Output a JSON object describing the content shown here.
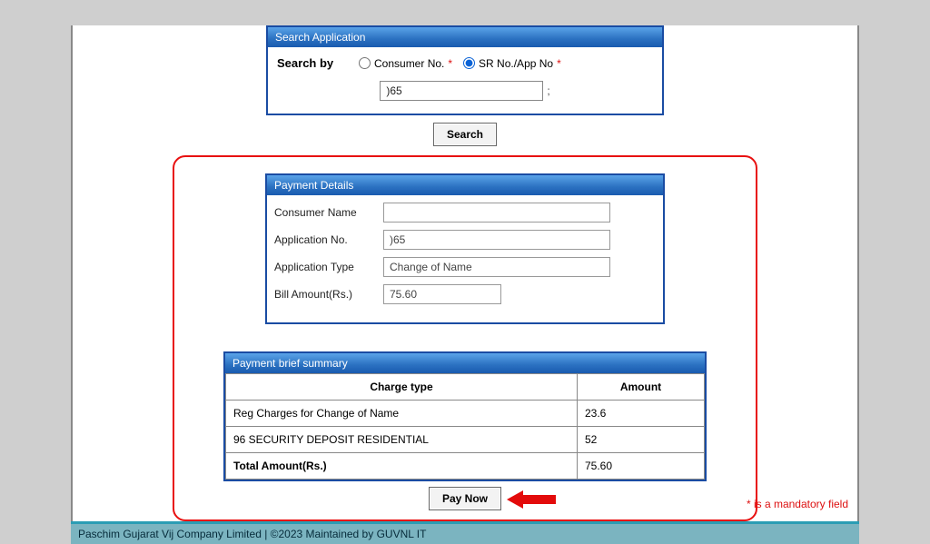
{
  "searchPanel": {
    "title": "Search Application",
    "searchByLabel": "Search by",
    "option1": "Consumer No.",
    "option2": "SR No./App No",
    "requiredMark": "*",
    "inputValue": ")65",
    "trailingChar": ";",
    "searchBtn": "Search"
  },
  "detailsPanel": {
    "title": "Payment Details",
    "fields": [
      {
        "label": "Consumer Name",
        "value": "",
        "short": false
      },
      {
        "label": "Application No.",
        "value": ")65",
        "short": false
      },
      {
        "label": "Application Type",
        "value": "Change of Name",
        "short": false
      },
      {
        "label": "Bill Amount(Rs.)",
        "value": "75.60",
        "short": true
      }
    ]
  },
  "summaryPanel": {
    "title": "Payment brief summary",
    "col1": "Charge type",
    "col2": "Amount",
    "rows": [
      {
        "charge": "Reg Charges for Change of Name",
        "amount": "23.6"
      },
      {
        "charge": "96 SECURITY DEPOSIT RESIDENTIAL",
        "amount": "52"
      }
    ],
    "totalLabel": "Total Amount(Rs.)",
    "totalAmount": "75.60"
  },
  "payNowBtn": "Pay Now",
  "mandatoryNote": "* is a mandatory field",
  "footer": "Paschim Gujarat Vij Company Limited | ©2023 Maintained by GUVNL IT"
}
